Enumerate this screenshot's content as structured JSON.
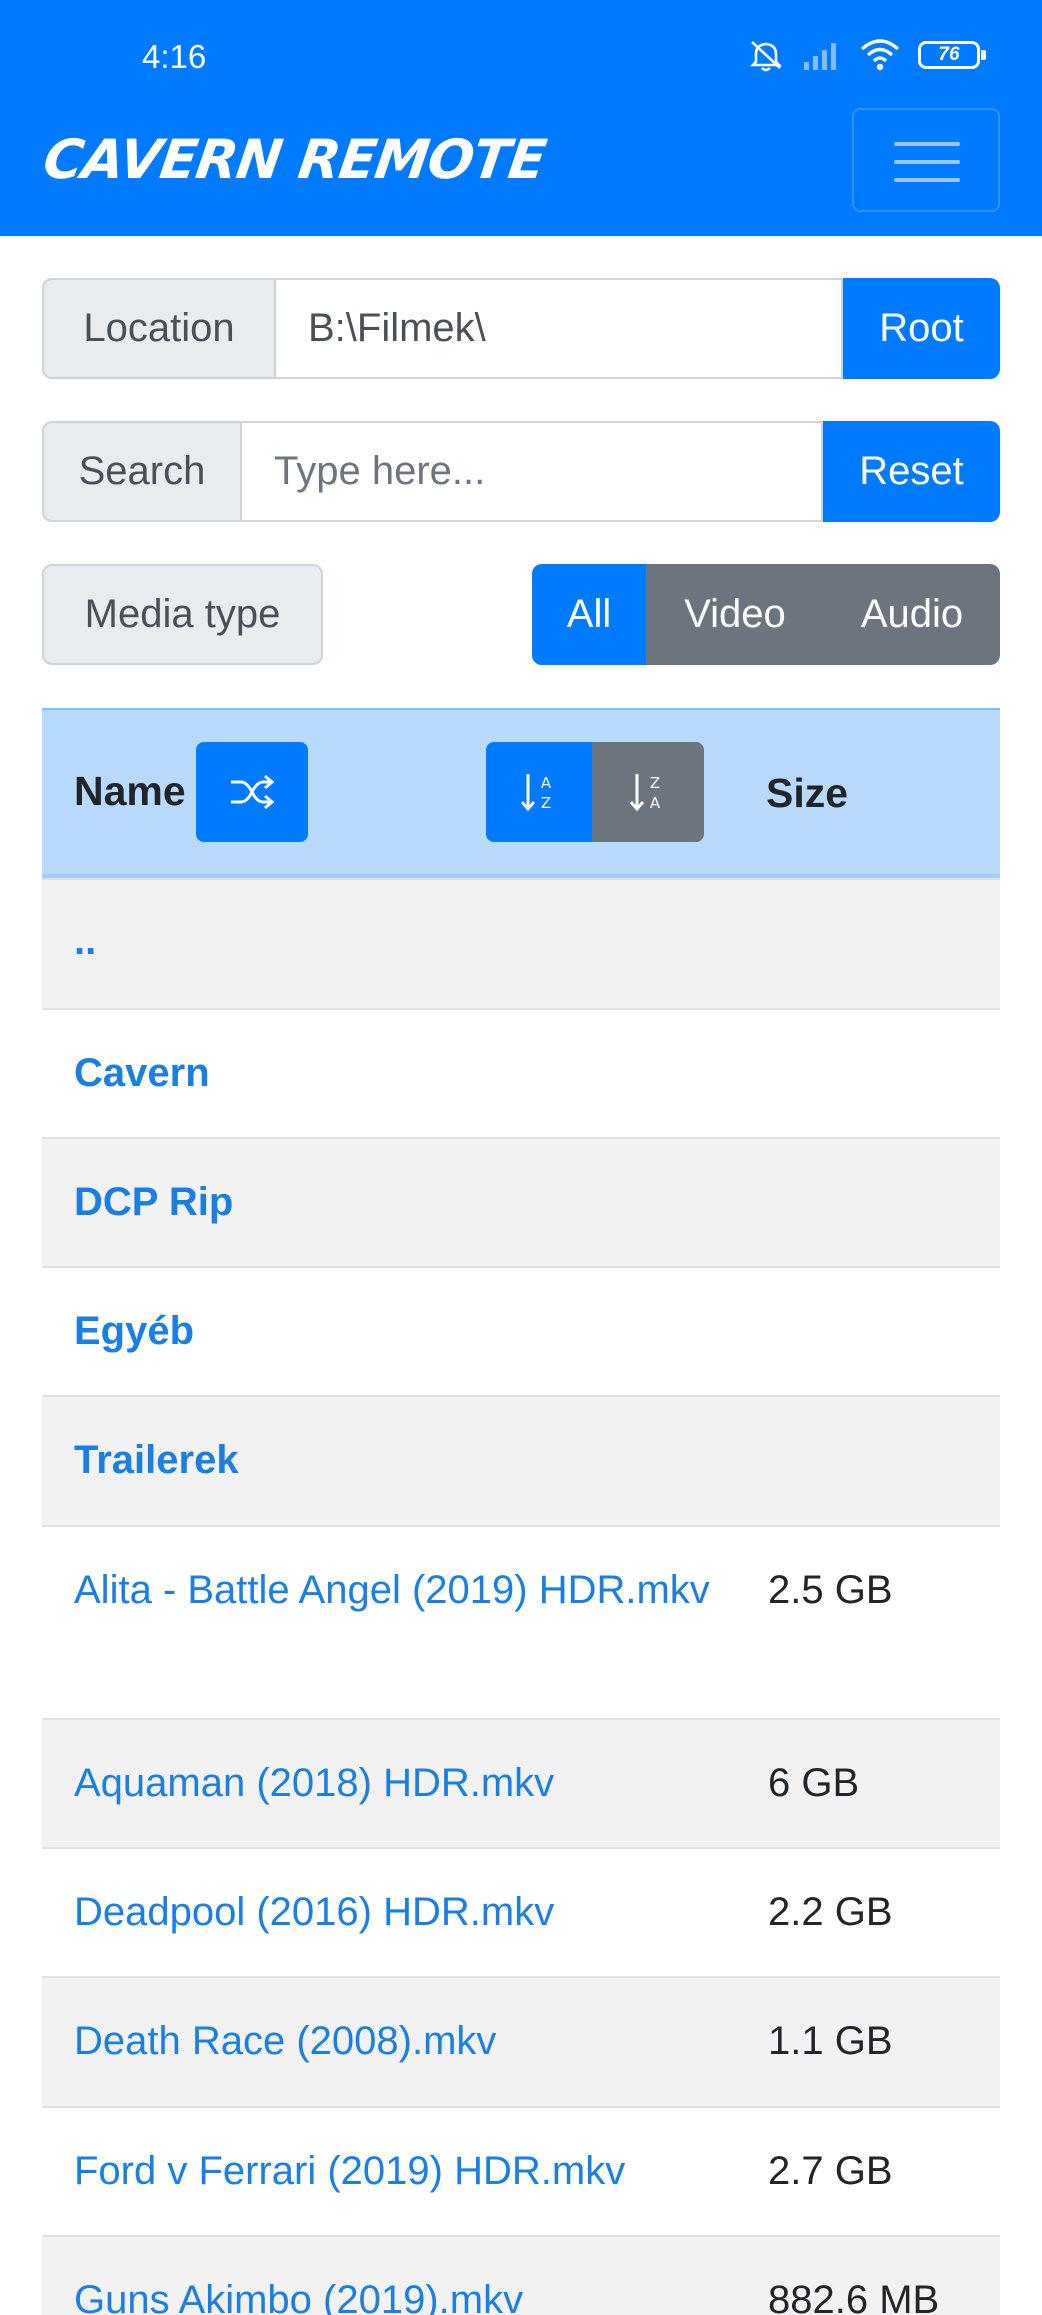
{
  "status": {
    "time": "4:16",
    "battery": "76"
  },
  "header": {
    "brand": "CAVERN REMOTE",
    "menu_icon": "hamburger-icon"
  },
  "location": {
    "label": "Location",
    "value": "B:\\Filmek\\",
    "button": "Root"
  },
  "search": {
    "label": "Search",
    "placeholder": "Type here...",
    "button": "Reset"
  },
  "media_type": {
    "label": "Media type",
    "options": [
      "All",
      "Video",
      "Audio"
    ],
    "selected": "All"
  },
  "table": {
    "headers": {
      "name": "Name",
      "size": "Size"
    },
    "icons": {
      "shuffle": "shuffle-icon",
      "sort_asc": "sort-a-z-icon",
      "sort_desc": "sort-z-a-icon"
    },
    "rows": [
      {
        "name": "..",
        "size": ""
      },
      {
        "name": "Cavern",
        "size": ""
      },
      {
        "name": "DCP Rip",
        "size": ""
      },
      {
        "name": "Egyéb",
        "size": ""
      },
      {
        "name": "Trailerek",
        "size": ""
      },
      {
        "name": "Alita - Battle Angel (2019) HDR.mkv",
        "size": "2.5 GB"
      },
      {
        "name": "Aquaman (2018) HDR.mkv",
        "size": "6 GB"
      },
      {
        "name": "Deadpool (2016) HDR.mkv",
        "size": "2.2 GB"
      },
      {
        "name": "Death Race (2008).mkv",
        "size": "1.1 GB"
      },
      {
        "name": "Ford v Ferrari (2019) HDR.mkv",
        "size": "2.7 GB"
      },
      {
        "name": "Guns Akimbo (2019).mkv",
        "size": "882.6 MB"
      }
    ]
  },
  "colors": {
    "primary": "#007bff",
    "secondary": "#6c757d",
    "header_row": "#b8daff",
    "link": "#1a7fe0"
  }
}
